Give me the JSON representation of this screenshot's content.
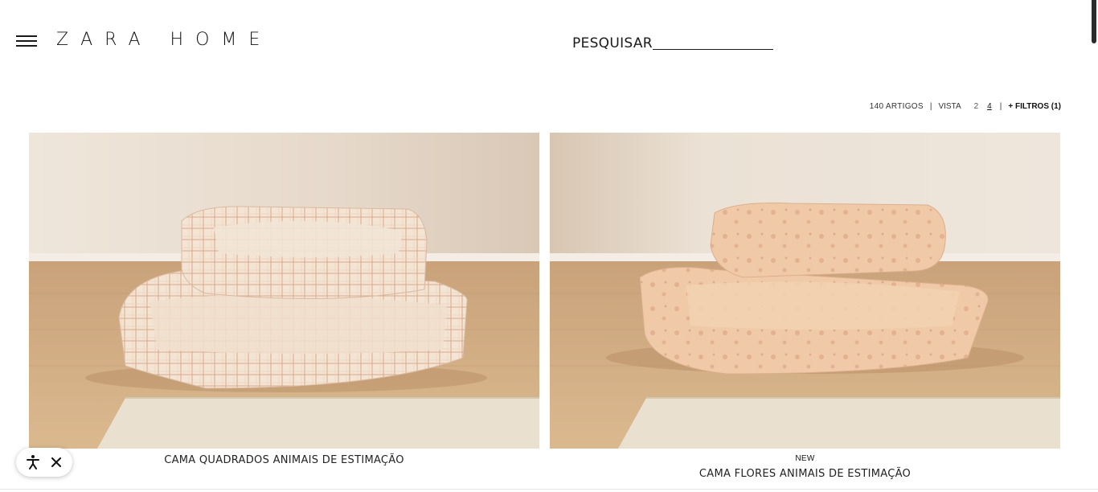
{
  "header": {
    "logo": "ZARA HOME",
    "search_label": "PESQUISAR",
    "menu_icon": "hamburger-menu-icon"
  },
  "toolbar": {
    "article_count": "140 ARTIGOS",
    "view_label": "VISTA",
    "view_options": [
      "2",
      "4"
    ],
    "active_view": "4",
    "filters_label": "+ FILTROS (1)"
  },
  "products": [
    {
      "badge": "",
      "name": "CAMA QUADRADOS ANIMAIS DE ESTIMAÇÃO"
    },
    {
      "badge": "NEW",
      "name": "CAMA FLORES ANIMAIS DE ESTIMAÇÃO"
    }
  ],
  "accessibility_widget": {
    "icons": [
      "accessibility-icon",
      "close-icon"
    ]
  },
  "colors": {
    "text": "#1a1a1a",
    "wall": "#e9ddd0",
    "floor": "#d4b086",
    "bed_check": "#f0ddca",
    "bed_floral": "#efc9a6"
  }
}
